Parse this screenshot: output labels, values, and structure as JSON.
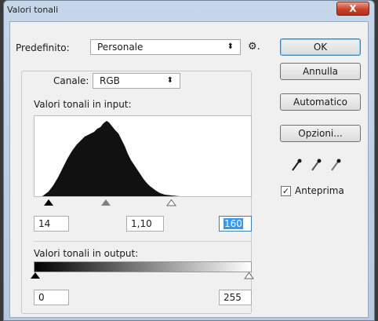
{
  "window": {
    "title": "Valori tonali",
    "close_label": "X"
  },
  "preset": {
    "label": "Predefinito:",
    "value": "Personale"
  },
  "channel": {
    "label": "Canale:",
    "value": "RGB"
  },
  "input_levels": {
    "label": "Valori tonali in input:",
    "black": "14",
    "gamma": "1,10",
    "white": "160"
  },
  "output_levels": {
    "label": "Valori tonali in output:",
    "black": "0",
    "white": "255"
  },
  "buttons": {
    "ok": "OK",
    "cancel": "Annulla",
    "auto": "Automatico",
    "options": "Opzioni..."
  },
  "preview": {
    "label": "Anteprima",
    "checked": true
  }
}
